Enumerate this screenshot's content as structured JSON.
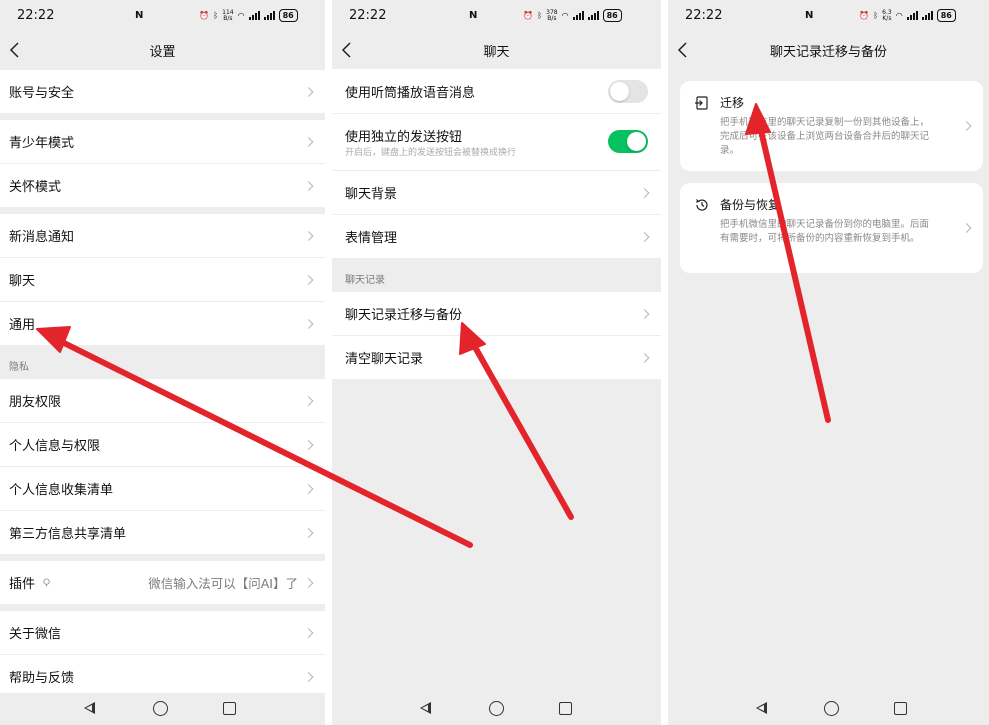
{
  "status": {
    "time": "22:22",
    "speed1": "114",
    "speed2": "378",
    "speed3": "6.3",
    "speed_unit": "B/s",
    "speed_unit3": "K/s",
    "battery": "86"
  },
  "panel1": {
    "title": "设置",
    "items": [
      {
        "label": "账号与安全"
      },
      {
        "label": "青少年模式"
      },
      {
        "label": "关怀模式"
      },
      {
        "label": "新消息通知"
      },
      {
        "label": "聊天"
      },
      {
        "label": "通用"
      },
      {
        "label": "朋友权限"
      },
      {
        "label": "个人信息与权限"
      },
      {
        "label": "个人信息收集清单"
      },
      {
        "label": "第三方信息共享清单"
      },
      {
        "label": "插件",
        "value": "微信输入法可以【问AI】了"
      },
      {
        "label": "关于微信"
      },
      {
        "label": "帮助与反馈"
      }
    ],
    "section_privacy": "隐私"
  },
  "panel2": {
    "title": "聊天",
    "items": [
      {
        "label": "使用听筒播放语音消息",
        "toggle": false
      },
      {
        "label": "使用独立的发送按钮",
        "sub": "开启后，键盘上的发送按钮会被替换成换行",
        "toggle": true
      },
      {
        "label": "聊天背景"
      },
      {
        "label": "表情管理"
      },
      {
        "label": "聊天记录迁移与备份"
      },
      {
        "label": "清空聊天记录"
      }
    ],
    "section_history": "聊天记录"
  },
  "panel3": {
    "title": "聊天记录迁移与备份",
    "cards": [
      {
        "title": "迁移",
        "desc": "把手机微信里的聊天记录复制一份到其他设备上，完成后可在该设备上浏览两台设备合并后的聊天记录。",
        "icon": "transfer-icon"
      },
      {
        "title": "备份与恢复",
        "desc": "把手机微信里的聊天记录备份到你的电脑里。后面有需要时，可将所备份的内容重新恢复到手机。",
        "icon": "history-icon"
      }
    ]
  },
  "colors": {
    "accent": "#07c160",
    "arrow": "#e3242b",
    "background": "#ededed"
  }
}
